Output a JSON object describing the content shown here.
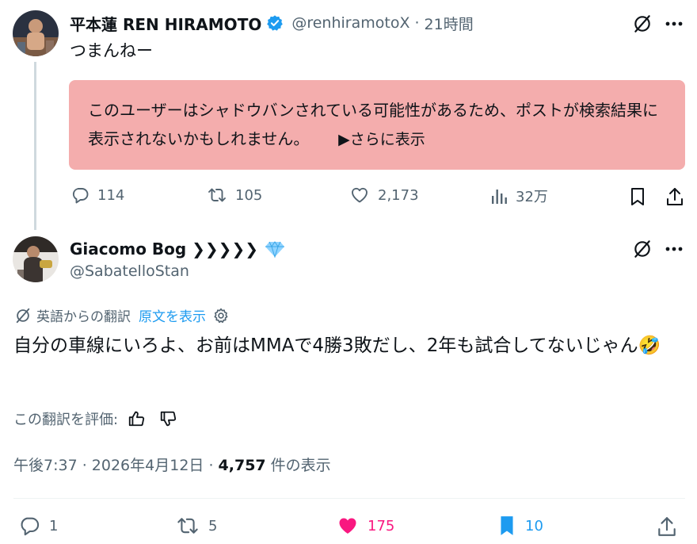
{
  "post1": {
    "display_name": "平本蓮 REN HIRAMOTO",
    "handle": "@renhiramotoX",
    "separator": "·",
    "time": "21時間",
    "text": "つまんねー",
    "warning_text": "このユーザーはシャドウバンされている可能性があるため、ポストが検索結果に表示されないかもしれません。",
    "warning_more": "▶さらに表示",
    "stats": {
      "replies": "114",
      "reposts": "105",
      "likes": "2,173",
      "views": "32万"
    }
  },
  "post2": {
    "display_name": "Giacomo Bog ❯❯❯❯❯",
    "handle": "@SabatelloStan",
    "translation_label": "英語からの翻訳",
    "show_original": "原文を表示",
    "text": "自分の車線にいろよ、お前はMMAで4勝3敗だし、2年も試合してないじゃん🤣",
    "rate_translation": "この翻訳を評価:",
    "timestamp": "午後7:37 · 2026年4月12日 · ",
    "views_count": "4,757",
    "views_suffix": " 件の表示",
    "stats": {
      "replies": "1",
      "reposts": "5",
      "likes": "175",
      "bookmarks": "10"
    }
  },
  "colors": {
    "warning_bg": "#f4adad",
    "verified": "#1d9bf0",
    "like_active": "#f91880",
    "bookmark_active": "#1d9bf0",
    "muted": "#536471"
  },
  "icons": [
    "verified-badge-icon",
    "grok-slash-icon",
    "more-icon",
    "reply-icon",
    "repost-icon",
    "like-icon",
    "views-icon",
    "bookmark-icon",
    "share-icon",
    "diamond-icon",
    "translate-icon",
    "settings-gear-icon",
    "thumbs-up-icon",
    "thumbs-down-icon"
  ]
}
